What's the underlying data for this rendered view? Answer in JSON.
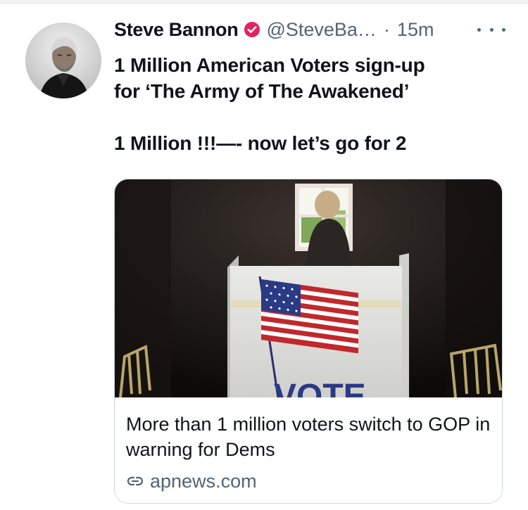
{
  "tweet": {
    "author": {
      "display_name": "Steve Bannon",
      "handle": "@SteveBa…",
      "verified_icon": "verified-badge-icon",
      "verified_color": "#e0245e"
    },
    "separator": "·",
    "time": "15m",
    "more_icon": "more-horizontal-icon",
    "text_lines": [
      "1 Million American Voters sign-up",
      "for ‘The Army of The Awakened’",
      "",
      "1 Million !!!—- now let’s go for 2"
    ],
    "link_card": {
      "image_text": "VOTE",
      "title": "More than 1 million voters switch to GOP in warning for Dems",
      "domain_icon": "link-icon",
      "domain": "apnews.com"
    }
  },
  "colors": {
    "text_primary": "#0f1419",
    "text_secondary": "#536471",
    "border": "#cfd9de"
  }
}
